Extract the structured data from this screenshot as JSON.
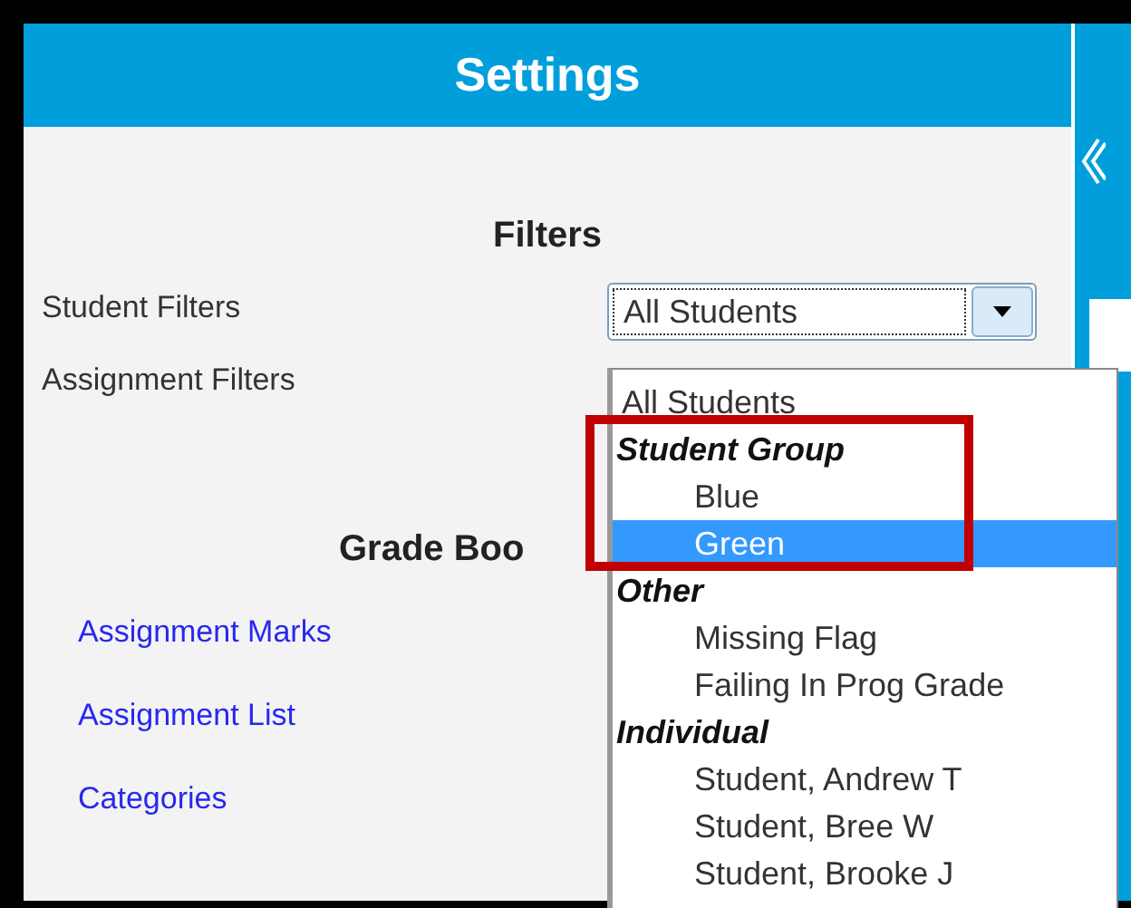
{
  "header": {
    "title": "Settings"
  },
  "filters": {
    "heading": "Filters",
    "student_filters": {
      "label": "Student Filters",
      "value": "All Students"
    },
    "assignment_filters": {
      "label": "Assignment Filters"
    }
  },
  "grade_book": {
    "heading": "Grade Boo",
    "links": [
      "Assignment Marks",
      "Assignment List",
      "Categories"
    ]
  },
  "dropdown": {
    "options": [
      {
        "label": "All Students",
        "kind": "option",
        "selected": false
      },
      {
        "label": "Student Group",
        "kind": "group",
        "selected": false
      },
      {
        "label": "Blue",
        "kind": "child",
        "selected": false
      },
      {
        "label": "Green",
        "kind": "child",
        "selected": true
      },
      {
        "label": "Other",
        "kind": "group",
        "selected": false
      },
      {
        "label": "Missing Flag",
        "kind": "child",
        "selected": false
      },
      {
        "label": "Failing In Prog Grade",
        "kind": "child",
        "selected": false
      },
      {
        "label": "Individual",
        "kind": "group",
        "selected": false
      },
      {
        "label": "Student, Andrew T",
        "kind": "child",
        "selected": false
      },
      {
        "label": "Student, Bree W",
        "kind": "child",
        "selected": false
      },
      {
        "label": "Student, Brooke J",
        "kind": "child",
        "selected": false
      }
    ]
  }
}
